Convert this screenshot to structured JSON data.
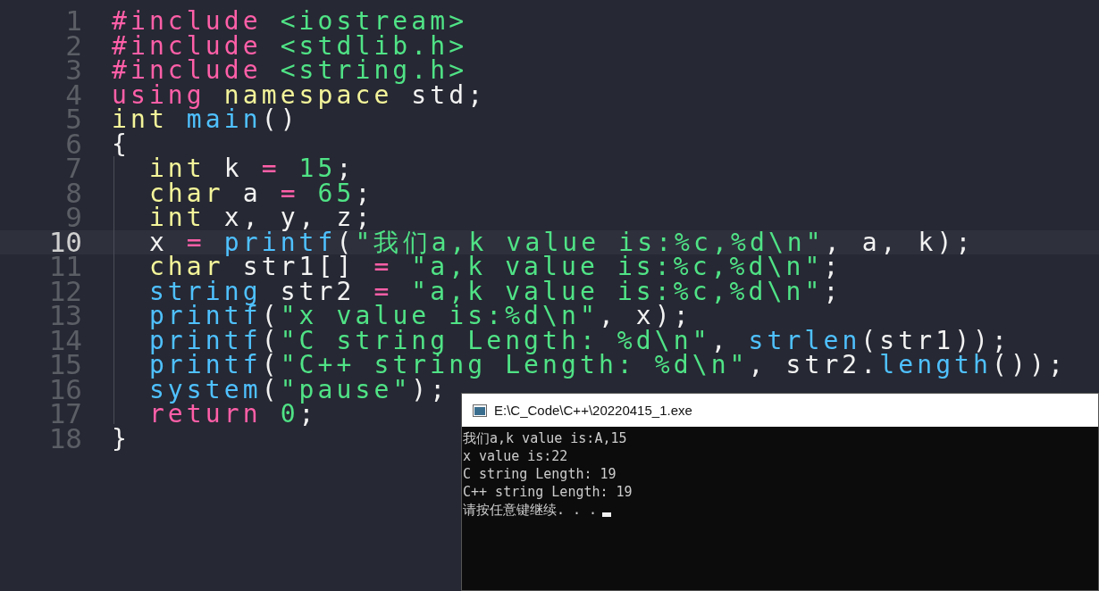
{
  "editor": {
    "lines": [
      {
        "number": "1",
        "current": false,
        "tokens": [
          {
            "kind": "keyword",
            "text": "#include"
          },
          {
            "kind": "string",
            "text": " <iostream>"
          }
        ]
      },
      {
        "number": "2",
        "current": false,
        "tokens": [
          {
            "kind": "keyword",
            "text": "#include"
          },
          {
            "kind": "string",
            "text": " <stdlib.h>"
          }
        ]
      },
      {
        "number": "3",
        "current": false,
        "tokens": [
          {
            "kind": "keyword",
            "text": "#include"
          },
          {
            "kind": "string",
            "text": " <string.h>"
          }
        ]
      },
      {
        "number": "4",
        "current": false,
        "tokens": [
          {
            "kind": "keyword",
            "text": "using"
          },
          {
            "kind": "type",
            "text": " namespace"
          },
          {
            "kind": "plain",
            "text": " std;"
          }
        ]
      },
      {
        "number": "5",
        "current": false,
        "tokens": [
          {
            "kind": "type",
            "text": "int"
          },
          {
            "kind": "func",
            "text": " main"
          },
          {
            "kind": "plain",
            "text": "()"
          }
        ]
      },
      {
        "number": "6",
        "current": false,
        "tokens": [
          {
            "kind": "plain",
            "text": "{"
          }
        ]
      },
      {
        "number": "7",
        "current": false,
        "tokens": [
          {
            "kind": "type",
            "text": "  int"
          },
          {
            "kind": "plain",
            "text": " k "
          },
          {
            "kind": "keyword",
            "text": "="
          },
          {
            "kind": "number",
            "text": " 15"
          },
          {
            "kind": "plain",
            "text": ";"
          }
        ]
      },
      {
        "number": "8",
        "current": false,
        "tokens": [
          {
            "kind": "type",
            "text": "  char"
          },
          {
            "kind": "plain",
            "text": " a "
          },
          {
            "kind": "keyword",
            "text": "="
          },
          {
            "kind": "number",
            "text": " 65"
          },
          {
            "kind": "plain",
            "text": ";"
          }
        ]
      },
      {
        "number": "9",
        "current": false,
        "tokens": [
          {
            "kind": "type",
            "text": "  int"
          },
          {
            "kind": "plain",
            "text": " x, y, z;"
          }
        ]
      },
      {
        "number": "10",
        "current": true,
        "tokens": [
          {
            "kind": "plain",
            "text": "  x "
          },
          {
            "kind": "keyword",
            "text": "="
          },
          {
            "kind": "func",
            "text": " printf"
          },
          {
            "kind": "plain",
            "text": "("
          },
          {
            "kind": "string",
            "text": "\"我们a,k value is:%c,%d\\n\""
          },
          {
            "kind": "plain",
            "text": ", a, k);"
          }
        ]
      },
      {
        "number": "11",
        "current": false,
        "tokens": [
          {
            "kind": "type",
            "text": "  char"
          },
          {
            "kind": "plain",
            "text": " str1[] "
          },
          {
            "kind": "keyword",
            "text": "="
          },
          {
            "kind": "string",
            "text": " \"a,k value is:%c,%d\\n\""
          },
          {
            "kind": "plain",
            "text": ";"
          }
        ]
      },
      {
        "number": "12",
        "current": false,
        "tokens": [
          {
            "kind": "func",
            "text": "  string"
          },
          {
            "kind": "plain",
            "text": " str2 "
          },
          {
            "kind": "keyword",
            "text": "="
          },
          {
            "kind": "string",
            "text": " \"a,k value is:%c,%d\\n\""
          },
          {
            "kind": "plain",
            "text": ";"
          }
        ]
      },
      {
        "number": "13",
        "current": false,
        "tokens": [
          {
            "kind": "func",
            "text": "  printf"
          },
          {
            "kind": "plain",
            "text": "("
          },
          {
            "kind": "string",
            "text": "\"x value is:%d\\n\""
          },
          {
            "kind": "plain",
            "text": ", x);"
          }
        ]
      },
      {
        "number": "14",
        "current": false,
        "tokens": [
          {
            "kind": "func",
            "text": "  printf"
          },
          {
            "kind": "plain",
            "text": "("
          },
          {
            "kind": "string",
            "text": "\"C string Length: %d\\n\""
          },
          {
            "kind": "plain",
            "text": ", "
          },
          {
            "kind": "func",
            "text": "strlen"
          },
          {
            "kind": "plain",
            "text": "(str1));"
          }
        ]
      },
      {
        "number": "15",
        "current": false,
        "tokens": [
          {
            "kind": "func",
            "text": "  printf"
          },
          {
            "kind": "plain",
            "text": "("
          },
          {
            "kind": "string",
            "text": "\"C++ string Length: %d\\n\""
          },
          {
            "kind": "plain",
            "text": ", str2."
          },
          {
            "kind": "func",
            "text": "length"
          },
          {
            "kind": "plain",
            "text": "());"
          }
        ]
      },
      {
        "number": "16",
        "current": false,
        "tokens": [
          {
            "kind": "func",
            "text": "  system"
          },
          {
            "kind": "plain",
            "text": "("
          },
          {
            "kind": "string",
            "text": "\"pause\""
          },
          {
            "kind": "plain",
            "text": ");"
          }
        ]
      },
      {
        "number": "17",
        "current": false,
        "tokens": [
          {
            "kind": "keyword",
            "text": "  return"
          },
          {
            "kind": "number",
            "text": " 0"
          },
          {
            "kind": "plain",
            "text": ";"
          }
        ]
      },
      {
        "number": "18",
        "current": false,
        "tokens": [
          {
            "kind": "plain",
            "text": "}"
          }
        ]
      }
    ]
  },
  "console": {
    "title": "E:\\C_Code\\C++\\20220415_1.exe",
    "lines": [
      "我们a,k value is:A,15",
      "x value is:22",
      "C string Length: 19",
      "C++ string Length: 19",
      "请按任意键继续. . ."
    ],
    "cursor": true
  }
}
